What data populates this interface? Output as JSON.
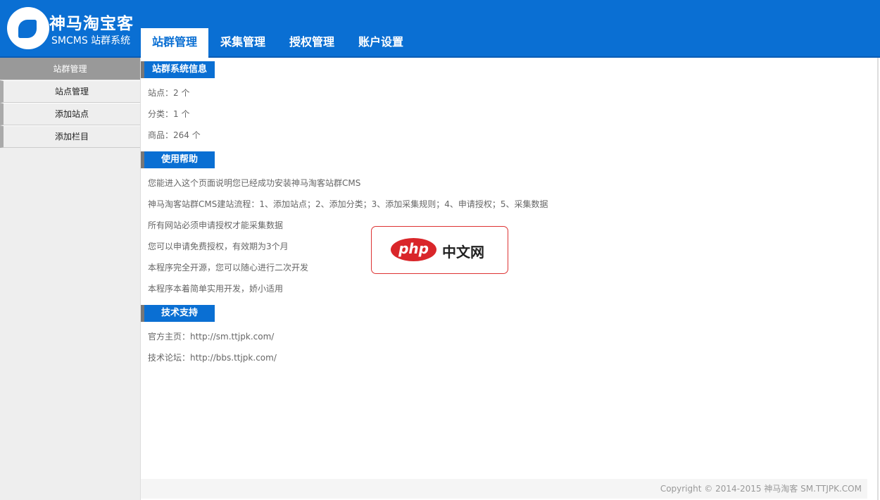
{
  "logo": {
    "name": "神马淘宝客",
    "subtitle": "SMCMS 站群系统"
  },
  "nav": [
    "站群管理",
    "采集管理",
    "授权管理",
    "账户设置"
  ],
  "sidebar": {
    "header": "站群管理",
    "items": [
      "站点管理",
      "添加站点",
      "添加栏目"
    ]
  },
  "sections": [
    {
      "title": "站群系统信息",
      "lines": [
        "站点：2 个",
        "分类：1 个",
        "商品：264 个"
      ]
    },
    {
      "title": "使用帮助",
      "lines": [
        "您能进入这个页面说明您已经成功安装神马淘客站群CMS",
        "神马淘客站群CMS建站流程：1、添加站点；2、添加分类；3、添加采集规则；4、申请授权；5、采集数据",
        "所有网站必须申请授权才能采集数据",
        "您可以申请免费授权，有效期为3个月",
        "本程序完全开源，您可以随心进行二次开发",
        "本程序本着简单实用开发，娇小适用"
      ]
    },
    {
      "title": "技术支持",
      "lines": [
        "官方主页：http://sm.ttjpk.com/",
        "技术论坛：http://bbs.ttjpk.com/"
      ]
    }
  ],
  "footer": "Copyright © 2014-2015 神马淘客   SM.TTJPK.COM",
  "watermark": {
    "badge": "php",
    "text": "中文网"
  }
}
